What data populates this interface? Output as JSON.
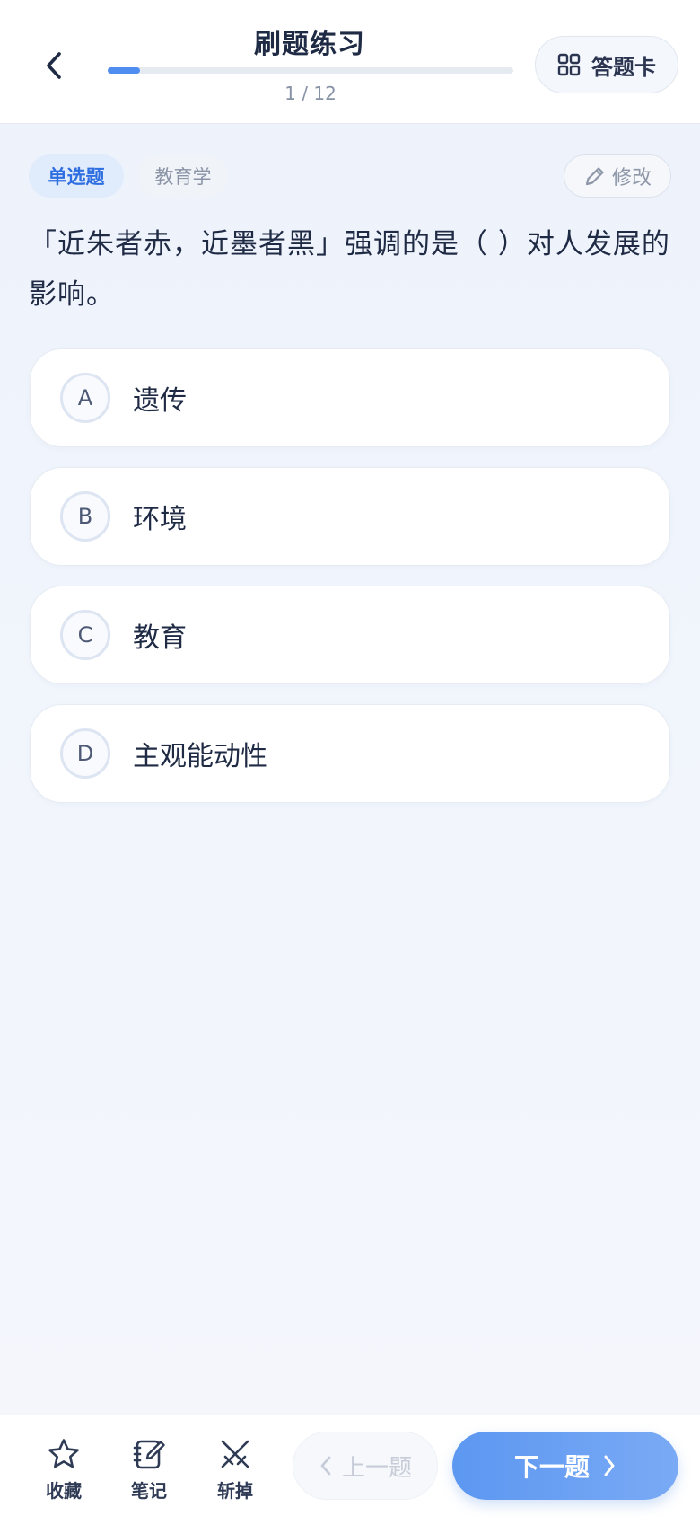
{
  "header": {
    "title": "刷题练习",
    "counter": "1 / 12",
    "progress": 0.08,
    "answer_card_label": "答题卡"
  },
  "question": {
    "type_tag": "单选题",
    "subject_tag": "教育学",
    "edit_label": "修改",
    "text": "「近朱者赤，近墨者黑」强调的是（ ）对人发展的影响。",
    "options": [
      {
        "letter": "A",
        "text": "遗传"
      },
      {
        "letter": "B",
        "text": "环境"
      },
      {
        "letter": "C",
        "text": "教育"
      },
      {
        "letter": "D",
        "text": "主观能动性"
      }
    ]
  },
  "bottom": {
    "favorite_label": "收藏",
    "notes_label": "笔记",
    "remove_label": "斩掉",
    "prev_label": "上一题",
    "next_label": "下一题"
  },
  "colors": {
    "accent": "#4f8ef0",
    "tag_bg": "#e0ebfc",
    "tag_text": "#2e6ee0"
  }
}
